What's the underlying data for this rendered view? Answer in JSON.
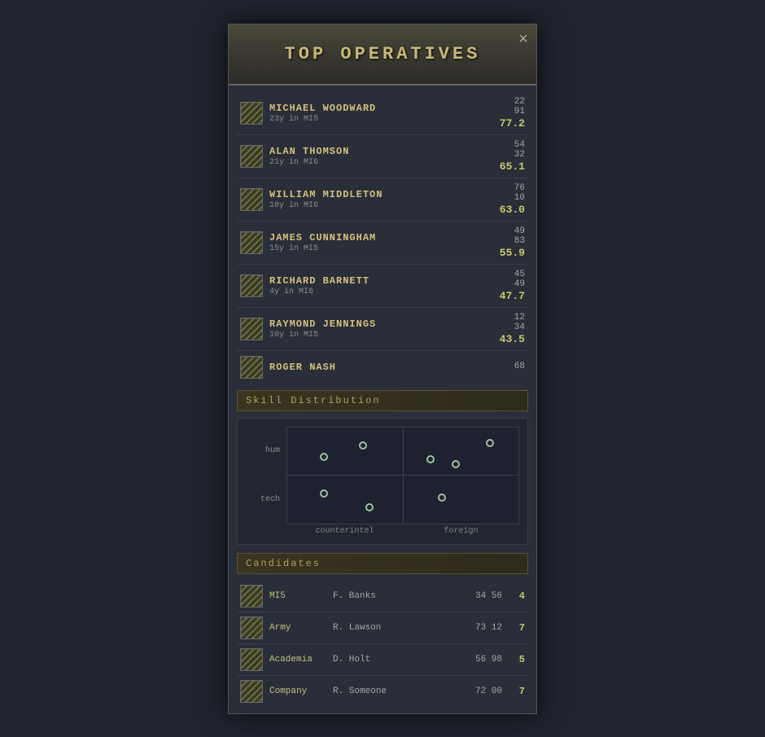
{
  "modal": {
    "title": "TOP OPERATIVES",
    "close_label": "×"
  },
  "operatives": [
    {
      "name": "MICHAEL WOODWARD",
      "sub": "23y in MI5",
      "stat1": "22",
      "stat2": "91",
      "score": "77.2"
    },
    {
      "name": "ALAN THOMSON",
      "sub": "21y in MI6",
      "stat1": "54",
      "stat2": "32",
      "score": "65.1"
    },
    {
      "name": "WILLIAM MIDDLETON",
      "sub": "18y in MI6",
      "stat1": "76",
      "stat2": "10",
      "score": "63.0"
    },
    {
      "name": "JAMES CUNNINGHAM",
      "sub": "15y in MI5",
      "stat1": "49",
      "stat2": "83",
      "score": "55.9"
    },
    {
      "name": "RICHARD BARNETT",
      "sub": "4y in MI6",
      "stat1": "45",
      "stat2": "49",
      "score": "47.7"
    },
    {
      "name": "RAYMOND JENNINGS",
      "sub": "10y in MI5",
      "stat1": "12",
      "stat2": "34",
      "score": "43.5"
    },
    {
      "name": "ROGER NASH",
      "sub": "",
      "stat1": "68",
      "stat2": "",
      "score": ""
    }
  ],
  "skill_section": {
    "label": "Skill Distribution",
    "y_labels": [
      "hum",
      "tech"
    ],
    "x_labels": [
      "counterintel",
      "foreign"
    ]
  },
  "candidates_section": {
    "label": "Candidates"
  },
  "candidates": [
    {
      "org": "MI5",
      "name": "F. Banks",
      "stats": "34 56",
      "score": "4"
    },
    {
      "org": "Army",
      "name": "R. Lawson",
      "stats": "73 12",
      "score": "7"
    },
    {
      "org": "Academia",
      "name": "D. Holt",
      "stats": "56 98",
      "score": "5"
    },
    {
      "org": "Company",
      "name": "R. Someone",
      "stats": "72 00",
      "score": "7"
    }
  ]
}
